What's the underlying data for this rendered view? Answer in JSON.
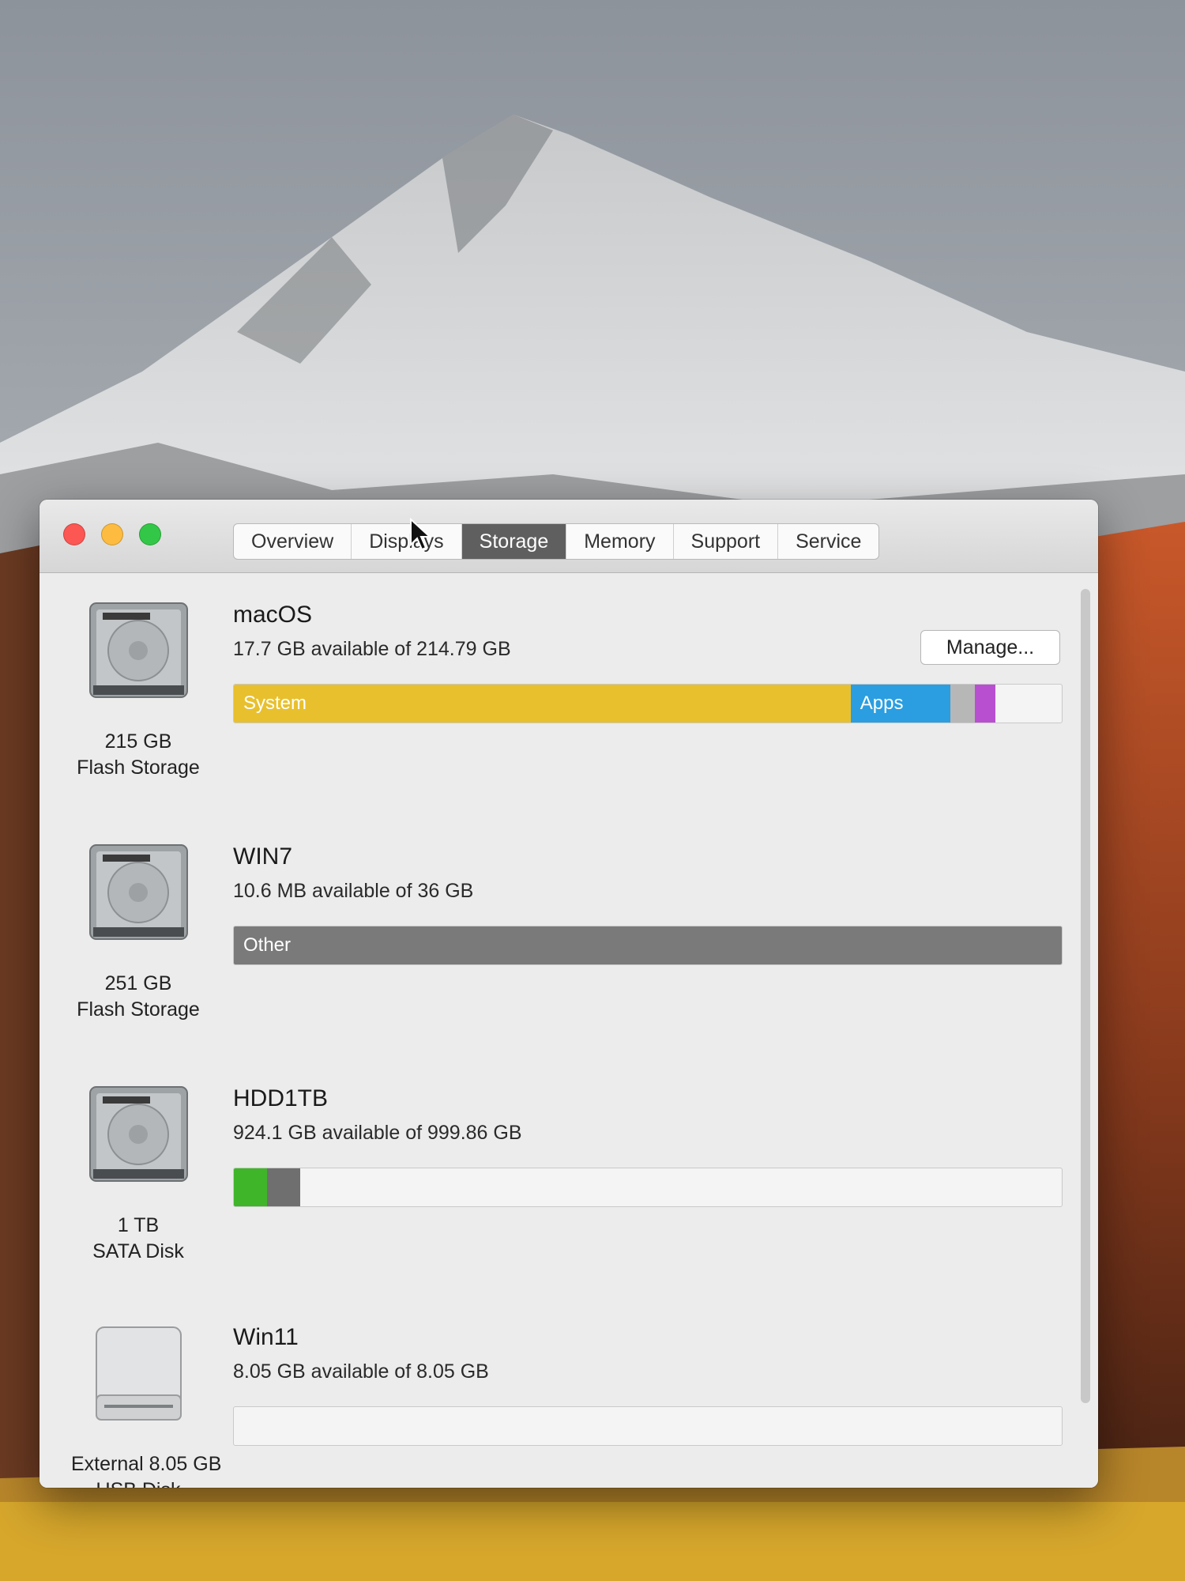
{
  "window": {
    "tabs": [
      {
        "label": "Overview",
        "active": false
      },
      {
        "label": "Displays",
        "active": false
      },
      {
        "label": "Storage",
        "active": true
      },
      {
        "label": "Memory",
        "active": false
      },
      {
        "label": "Support",
        "active": false
      },
      {
        "label": "Service",
        "active": false
      }
    ]
  },
  "disks": [
    {
      "volume_name": "macOS",
      "available_text": "17.7 GB available of 214.79 GB",
      "capacity_label": "215 GB",
      "type_label": "Flash Storage",
      "icon": "internal-disk-icon",
      "manage_label": "Manage...",
      "segments": [
        {
          "label": "System",
          "fraction": 0.745,
          "color": "#e8c02e"
        },
        {
          "label": "Apps",
          "fraction": 0.12,
          "color": "#2a9ee0"
        },
        {
          "label": "",
          "fraction": 0.03,
          "color": "#b7b7b7"
        },
        {
          "label": "",
          "fraction": 0.025,
          "color": "#b84fd0"
        }
      ]
    },
    {
      "volume_name": "WIN7",
      "available_text": "10.6 MB available of 36 GB",
      "capacity_label": "251 GB",
      "type_label": "Flash Storage",
      "icon": "internal-disk-icon",
      "segments": [
        {
          "label": "Other",
          "fraction": 1.0,
          "color": "#7a7a7a"
        }
      ]
    },
    {
      "volume_name": "HDD1TB",
      "available_text": "924.1 GB available of 999.86 GB",
      "capacity_label": "1 TB",
      "type_label": "SATA Disk",
      "icon": "internal-disk-icon",
      "segments": [
        {
          "label": "",
          "fraction": 0.04,
          "color": "#3fb52a"
        },
        {
          "label": "",
          "fraction": 0.04,
          "color": "#6f6f6f"
        }
      ]
    },
    {
      "volume_name": "Win11",
      "available_text": "8.05 GB available of 8.05 GB",
      "capacity_label": "External 8.05 GB",
      "type_label": "USB Disk",
      "icon": "external-disk-icon",
      "segments": []
    }
  ]
}
